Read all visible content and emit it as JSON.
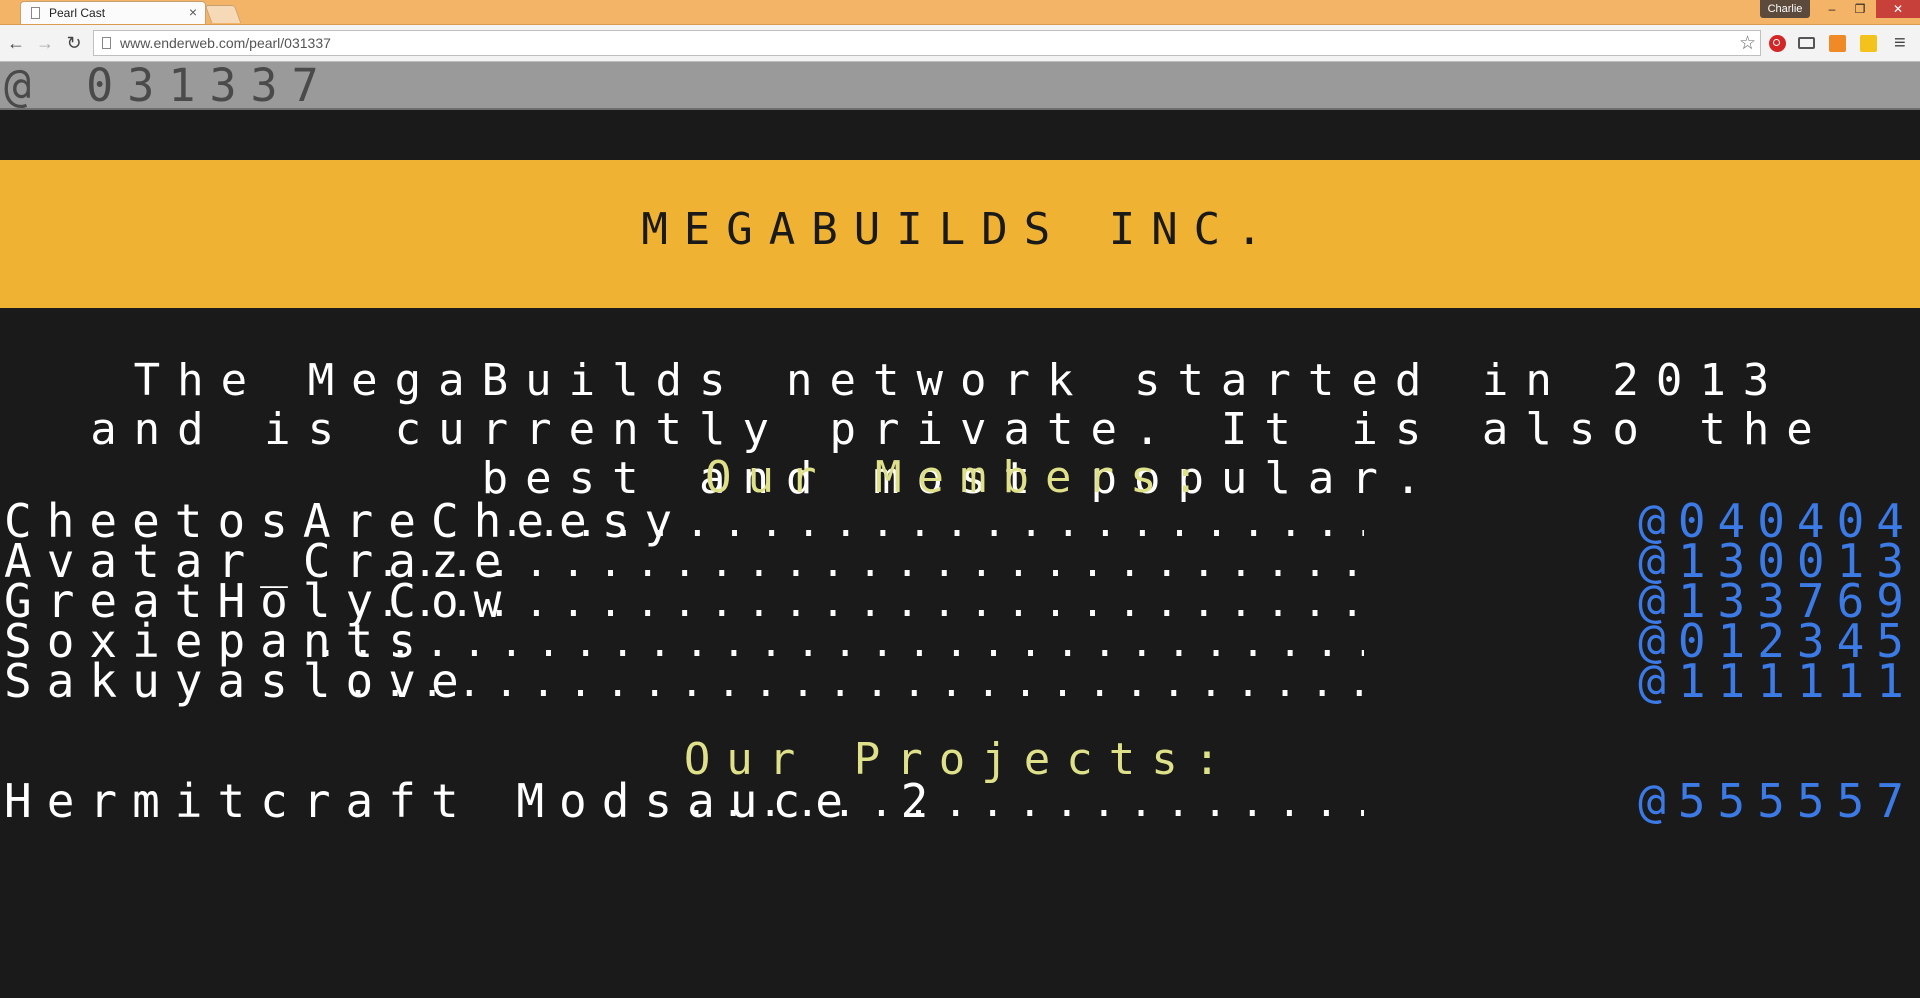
{
  "browser": {
    "tab_title": "Pearl Cast",
    "tab_close": "×",
    "profile_name": "Charlie",
    "url": "www.enderweb.com/pearl/031337",
    "controls": {
      "minimize": "–",
      "maximize": "❐",
      "close": "✕"
    },
    "nav": {
      "back": "←",
      "forward": "→",
      "reload": "↻",
      "star": "☆",
      "menu": "≡"
    },
    "icons": [
      "page-icon",
      "back-icon",
      "forward-icon",
      "reload-icon",
      "star-icon",
      "opera-icon",
      "cast-icon",
      "chart-icon",
      "grid-extension-icon",
      "menu-icon"
    ]
  },
  "page": {
    "address": "@ 031337",
    "banner_title": "MEGABUILDS INC.",
    "intro": "The MegaBuilds network started in 2013 and is currently private. It is also the best and most popular.",
    "members_heading": "Our Members:",
    "members": [
      {
        "name": "CheetosAreCheesy",
        "code": "@040404"
      },
      {
        "name": "Avatar_Craze",
        "code": "@130013"
      },
      {
        "name": "GreatHolyCow",
        "code": "@133769"
      },
      {
        "name": "Soxiepants",
        "code": "@012345"
      },
      {
        "name": "Sakuyaslove",
        "code": "@111111"
      }
    ],
    "projects_heading": "Our Projects:",
    "projects": [
      {
        "name": "Hermitcraft Modsauce 2",
        "code": "@555557"
      }
    ]
  },
  "colors": {
    "titlebar": "#f4b468",
    "page_background": "#1a1a1a",
    "banner": "#f0b232",
    "heading": "#dfe08a",
    "link": "#3c7ae6",
    "address_bar": "#9a9a9a"
  }
}
